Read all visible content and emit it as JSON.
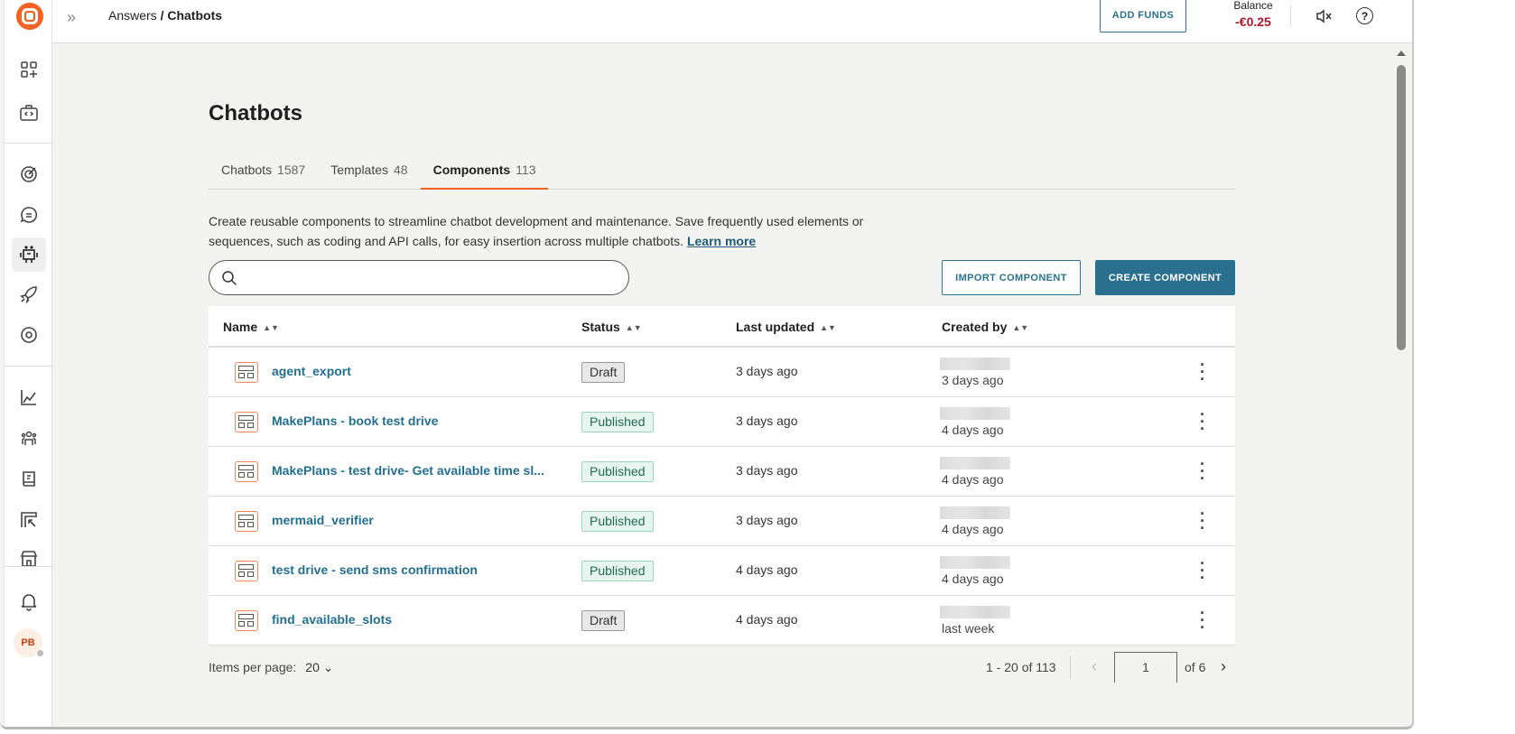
{
  "header": {
    "breadcrumb_parent": "Answers",
    "breadcrumb_sep": " / ",
    "breadcrumb_current": "Chatbots",
    "add_funds": "ADD FUNDS",
    "balance_label": "Balance",
    "balance_value": "-€0.25"
  },
  "sidebar": {
    "avatar_initials": "PB"
  },
  "page": {
    "title": "Chatbots",
    "tabs": [
      {
        "label": "Chatbots",
        "count": "1587"
      },
      {
        "label": "Templates",
        "count": "48"
      },
      {
        "label": "Components",
        "count": "113",
        "active": true
      }
    ],
    "description": "Create reusable components to streamline chatbot development and maintenance. Save frequently used elements or sequences, such as coding and API calls, for easy insertion across multiple chatbots. ",
    "learn_more": "Learn more",
    "search_placeholder": "",
    "import_label": "IMPORT COMPONENT",
    "create_label": "CREATE COMPONENT"
  },
  "table": {
    "columns": [
      "Name",
      "Status",
      "Last updated",
      "Created by"
    ],
    "rows": [
      {
        "name": "agent_export",
        "status": "Draft",
        "updated": "3 days ago",
        "created": "3 days ago"
      },
      {
        "name": "MakePlans - book test drive",
        "status": "Published",
        "updated": "3 days ago",
        "created": "4 days ago"
      },
      {
        "name": "MakePlans - test drive- Get available time sl...",
        "status": "Published",
        "updated": "3 days ago",
        "created": "4 days ago"
      },
      {
        "name": "mermaid_verifier",
        "status": "Published",
        "updated": "3 days ago",
        "created": "4 days ago"
      },
      {
        "name": "test drive - send sms confirmation",
        "status": "Published",
        "updated": "4 days ago",
        "created": "4 days ago"
      },
      {
        "name": "find_available_slots",
        "status": "Draft",
        "updated": "4 days ago",
        "created": "last week"
      }
    ]
  },
  "pagination": {
    "items_per_page_label": "Items per page:",
    "items_per_page": "20",
    "range": "1 - 20 of 113",
    "page": "1",
    "of_pages": "of 6"
  },
  "colors": {
    "accent": "#f26322",
    "primary": "#2a6f8e",
    "balance_negative": "#b0172a"
  }
}
